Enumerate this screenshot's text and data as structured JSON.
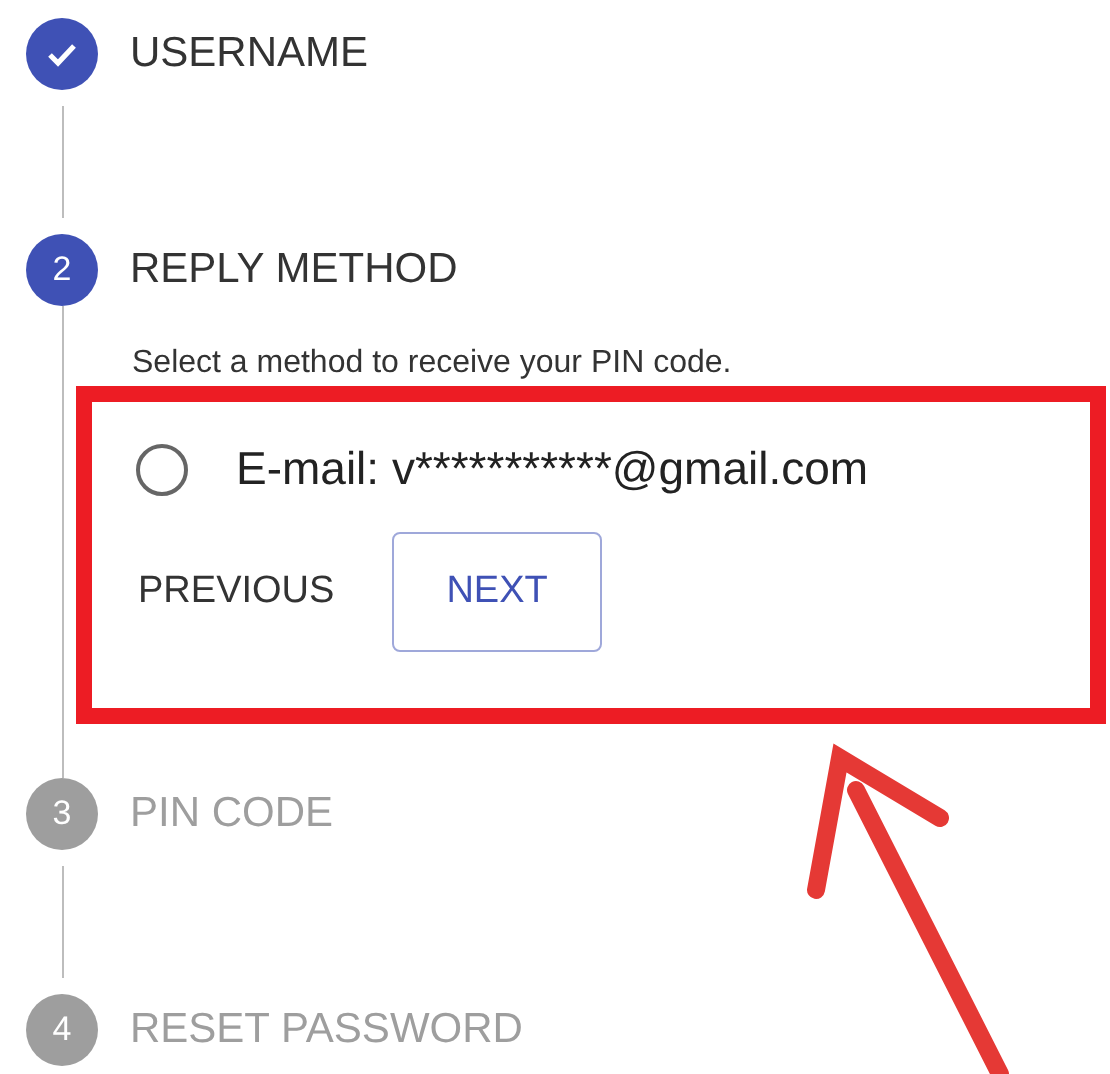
{
  "steps": [
    {
      "label": "USERNAME",
      "completed": true,
      "active": false
    },
    {
      "number": "2",
      "label": "REPLY METHOD",
      "completed": false,
      "active": true,
      "description": "Select a method to receive your PIN code.",
      "option": {
        "label": "E-mail: v***********@gmail.com",
        "selected": false
      },
      "buttons": [
        {
          "label": "PREVIOUS",
          "kind": "text"
        },
        {
          "label": "NEXT",
          "kind": "outlined"
        }
      ]
    },
    {
      "number": "3",
      "label": "PIN CODE",
      "completed": false,
      "active": false
    },
    {
      "number": "4",
      "label": "RESET PASSWORD",
      "completed": false,
      "active": false
    }
  ]
}
